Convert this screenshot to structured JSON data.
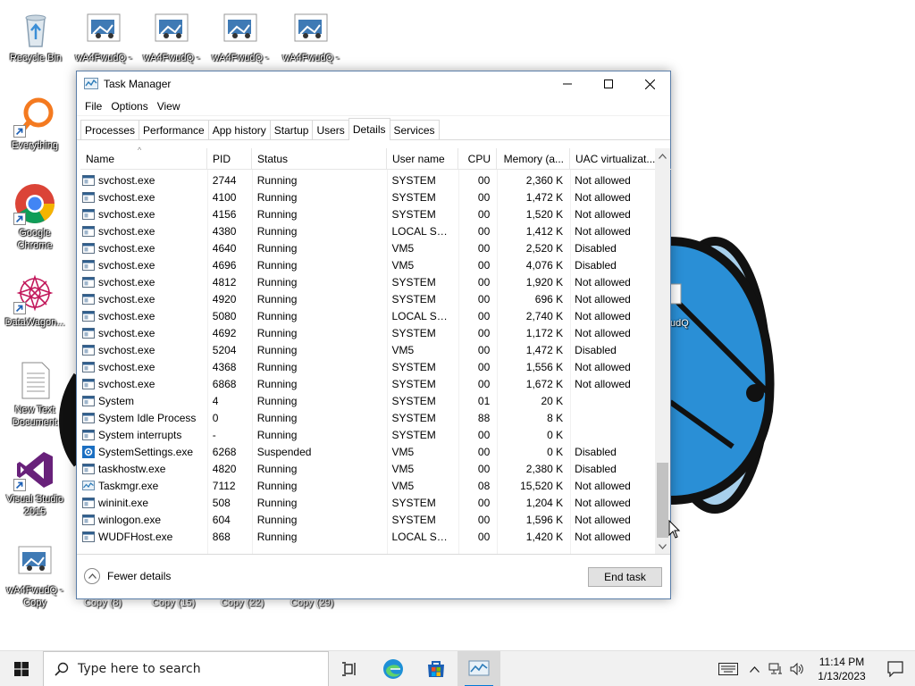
{
  "desktop": {
    "top_icons": [
      {
        "label": "Recycle Bin",
        "icon": "recycle-bin-icon"
      },
      {
        "label": "wA4FwudQ -",
        "icon": "file-shortcut-icon"
      },
      {
        "label": "wA4FwudQ -",
        "icon": "file-shortcut-icon"
      },
      {
        "label": "wA4FwudQ -",
        "icon": "file-shortcut-icon"
      },
      {
        "label": "wA4FwudQ -",
        "icon": "file-shortcut-icon"
      }
    ],
    "left_icons": [
      {
        "label": "Everything",
        "icon": "everything-search-icon"
      },
      {
        "label": "Google",
        "label2": "Chrome",
        "icon": "chrome-icon"
      },
      {
        "label": "DataWagon...",
        "icon": "datawagon-icon"
      },
      {
        "label": "New Text",
        "label2": "Document",
        "icon": "text-document-icon"
      },
      {
        "label": "Visual Studio",
        "label2": "2015",
        "icon": "visual-studio-icon"
      },
      {
        "label": "wA4FwudQ -",
        "label2": "Copy",
        "icon": "file-shortcut-icon"
      }
    ],
    "under_labels": [
      "Copy (8)",
      "Copy (15)",
      "Copy (22)",
      "Copy (29)"
    ],
    "partial_label": "udQ"
  },
  "task_manager": {
    "title": "Task Manager",
    "menu": [
      "File",
      "Options",
      "View"
    ],
    "tabs": [
      "Processes",
      "Performance",
      "App history",
      "Startup",
      "Users",
      "Details",
      "Services"
    ],
    "active_tab": "Details",
    "columns": {
      "name": "Name",
      "pid": "PID",
      "status": "Status",
      "user": "User name",
      "cpu": "CPU",
      "memory": "Memory (a...",
      "uac": "UAC virtualizat..."
    },
    "rows": [
      {
        "name": "svchost.exe",
        "pid": "2744",
        "status": "Running",
        "user": "SYSTEM",
        "cpu": "00",
        "mem": "2,360 K",
        "uac": "Not allowed",
        "icon": "generic"
      },
      {
        "name": "svchost.exe",
        "pid": "4100",
        "status": "Running",
        "user": "SYSTEM",
        "cpu": "00",
        "mem": "1,472 K",
        "uac": "Not allowed",
        "icon": "generic"
      },
      {
        "name": "svchost.exe",
        "pid": "4156",
        "status": "Running",
        "user": "SYSTEM",
        "cpu": "00",
        "mem": "1,520 K",
        "uac": "Not allowed",
        "icon": "generic"
      },
      {
        "name": "svchost.exe",
        "pid": "4380",
        "status": "Running",
        "user": "LOCAL SE...",
        "cpu": "00",
        "mem": "1,412 K",
        "uac": "Not allowed",
        "icon": "generic"
      },
      {
        "name": "svchost.exe",
        "pid": "4640",
        "status": "Running",
        "user": "VM5",
        "cpu": "00",
        "mem": "2,520 K",
        "uac": "Disabled",
        "icon": "generic"
      },
      {
        "name": "svchost.exe",
        "pid": "4696",
        "status": "Running",
        "user": "VM5",
        "cpu": "00",
        "mem": "4,076 K",
        "uac": "Disabled",
        "icon": "generic"
      },
      {
        "name": "svchost.exe",
        "pid": "4812",
        "status": "Running",
        "user": "SYSTEM",
        "cpu": "00",
        "mem": "1,920 K",
        "uac": "Not allowed",
        "icon": "generic"
      },
      {
        "name": "svchost.exe",
        "pid": "4920",
        "status": "Running",
        "user": "SYSTEM",
        "cpu": "00",
        "mem": "696 K",
        "uac": "Not allowed",
        "icon": "generic"
      },
      {
        "name": "svchost.exe",
        "pid": "5080",
        "status": "Running",
        "user": "LOCAL SE...",
        "cpu": "00",
        "mem": "2,740 K",
        "uac": "Not allowed",
        "icon": "generic"
      },
      {
        "name": "svchost.exe",
        "pid": "4692",
        "status": "Running",
        "user": "SYSTEM",
        "cpu": "00",
        "mem": "1,172 K",
        "uac": "Not allowed",
        "icon": "generic"
      },
      {
        "name": "svchost.exe",
        "pid": "5204",
        "status": "Running",
        "user": "VM5",
        "cpu": "00",
        "mem": "1,472 K",
        "uac": "Disabled",
        "icon": "generic"
      },
      {
        "name": "svchost.exe",
        "pid": "4368",
        "status": "Running",
        "user": "SYSTEM",
        "cpu": "00",
        "mem": "1,556 K",
        "uac": "Not allowed",
        "icon": "generic"
      },
      {
        "name": "svchost.exe",
        "pid": "6868",
        "status": "Running",
        "user": "SYSTEM",
        "cpu": "00",
        "mem": "1,672 K",
        "uac": "Not allowed",
        "icon": "generic"
      },
      {
        "name": "System",
        "pid": "4",
        "status": "Running",
        "user": "SYSTEM",
        "cpu": "01",
        "mem": "20 K",
        "uac": "",
        "icon": "system"
      },
      {
        "name": "System Idle Process",
        "pid": "0",
        "status": "Running",
        "user": "SYSTEM",
        "cpu": "88",
        "mem": "8 K",
        "uac": "",
        "icon": "system"
      },
      {
        "name": "System interrupts",
        "pid": "-",
        "status": "Running",
        "user": "SYSTEM",
        "cpu": "00",
        "mem": "0 K",
        "uac": "",
        "icon": "system"
      },
      {
        "name": "SystemSettings.exe",
        "pid": "6268",
        "status": "Suspended",
        "user": "VM5",
        "cpu": "00",
        "mem": "0 K",
        "uac": "Disabled",
        "icon": "settings"
      },
      {
        "name": "taskhostw.exe",
        "pid": "4820",
        "status": "Running",
        "user": "VM5",
        "cpu": "00",
        "mem": "2,380 K",
        "uac": "Disabled",
        "icon": "generic"
      },
      {
        "name": "Taskmgr.exe",
        "pid": "7112",
        "status": "Running",
        "user": "VM5",
        "cpu": "08",
        "mem": "15,520 K",
        "uac": "Not allowed",
        "icon": "taskmgr"
      },
      {
        "name": "wininit.exe",
        "pid": "508",
        "status": "Running",
        "user": "SYSTEM",
        "cpu": "00",
        "mem": "1,204 K",
        "uac": "Not allowed",
        "icon": "generic"
      },
      {
        "name": "winlogon.exe",
        "pid": "604",
        "status": "Running",
        "user": "SYSTEM",
        "cpu": "00",
        "mem": "1,596 K",
        "uac": "Not allowed",
        "icon": "generic"
      },
      {
        "name": "WUDFHost.exe",
        "pid": "868",
        "status": "Running",
        "user": "LOCAL SE...",
        "cpu": "00",
        "mem": "1,420 K",
        "uac": "Not allowed",
        "icon": "generic"
      }
    ],
    "fewer_details": "Fewer details",
    "end_task": "End task"
  },
  "taskbar": {
    "search_placeholder": "Type here to search",
    "time": "11:14 PM",
    "date": "1/13/2023"
  },
  "colors": {
    "accent": "#0078d7",
    "window_border": "#5a7ea8",
    "wallpaper_blue": "#2a8fd6",
    "wallpaper_light": "#a8d0ec"
  }
}
